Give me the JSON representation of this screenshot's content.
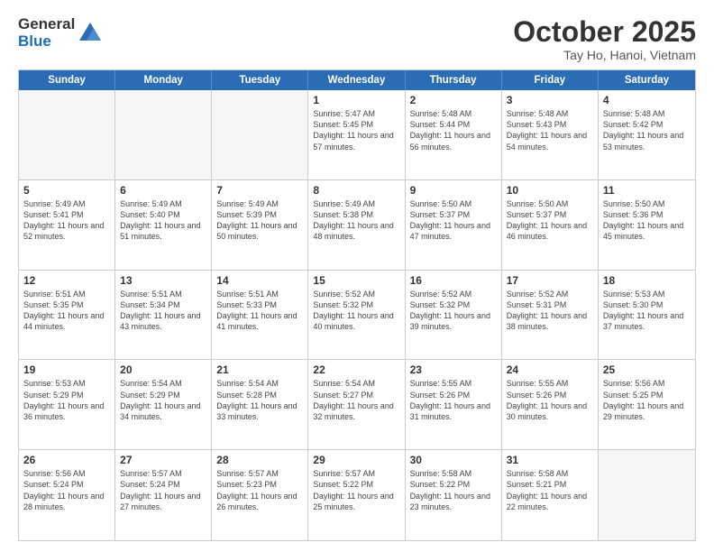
{
  "header": {
    "logo_general": "General",
    "logo_blue": "Blue",
    "month_title": "October 2025",
    "subtitle": "Tay Ho, Hanoi, Vietnam"
  },
  "days_of_week": [
    "Sunday",
    "Monday",
    "Tuesday",
    "Wednesday",
    "Thursday",
    "Friday",
    "Saturday"
  ],
  "weeks": [
    [
      {
        "day": "",
        "info": "",
        "empty": true
      },
      {
        "day": "",
        "info": "",
        "empty": true
      },
      {
        "day": "",
        "info": "",
        "empty": true
      },
      {
        "day": "1",
        "info": "Sunrise: 5:47 AM\nSunset: 5:45 PM\nDaylight: 11 hours\nand 57 minutes."
      },
      {
        "day": "2",
        "info": "Sunrise: 5:48 AM\nSunset: 5:44 PM\nDaylight: 11 hours\nand 56 minutes."
      },
      {
        "day": "3",
        "info": "Sunrise: 5:48 AM\nSunset: 5:43 PM\nDaylight: 11 hours\nand 54 minutes."
      },
      {
        "day": "4",
        "info": "Sunrise: 5:48 AM\nSunset: 5:42 PM\nDaylight: 11 hours\nand 53 minutes."
      }
    ],
    [
      {
        "day": "5",
        "info": "Sunrise: 5:49 AM\nSunset: 5:41 PM\nDaylight: 11 hours\nand 52 minutes."
      },
      {
        "day": "6",
        "info": "Sunrise: 5:49 AM\nSunset: 5:40 PM\nDaylight: 11 hours\nand 51 minutes."
      },
      {
        "day": "7",
        "info": "Sunrise: 5:49 AM\nSunset: 5:39 PM\nDaylight: 11 hours\nand 50 minutes."
      },
      {
        "day": "8",
        "info": "Sunrise: 5:49 AM\nSunset: 5:38 PM\nDaylight: 11 hours\nand 48 minutes."
      },
      {
        "day": "9",
        "info": "Sunrise: 5:50 AM\nSunset: 5:37 PM\nDaylight: 11 hours\nand 47 minutes."
      },
      {
        "day": "10",
        "info": "Sunrise: 5:50 AM\nSunset: 5:37 PM\nDaylight: 11 hours\nand 46 minutes."
      },
      {
        "day": "11",
        "info": "Sunrise: 5:50 AM\nSunset: 5:36 PM\nDaylight: 11 hours\nand 45 minutes."
      }
    ],
    [
      {
        "day": "12",
        "info": "Sunrise: 5:51 AM\nSunset: 5:35 PM\nDaylight: 11 hours\nand 44 minutes."
      },
      {
        "day": "13",
        "info": "Sunrise: 5:51 AM\nSunset: 5:34 PM\nDaylight: 11 hours\nand 43 minutes."
      },
      {
        "day": "14",
        "info": "Sunrise: 5:51 AM\nSunset: 5:33 PM\nDaylight: 11 hours\nand 41 minutes."
      },
      {
        "day": "15",
        "info": "Sunrise: 5:52 AM\nSunset: 5:32 PM\nDaylight: 11 hours\nand 40 minutes."
      },
      {
        "day": "16",
        "info": "Sunrise: 5:52 AM\nSunset: 5:32 PM\nDaylight: 11 hours\nand 39 minutes."
      },
      {
        "day": "17",
        "info": "Sunrise: 5:52 AM\nSunset: 5:31 PM\nDaylight: 11 hours\nand 38 minutes."
      },
      {
        "day": "18",
        "info": "Sunrise: 5:53 AM\nSunset: 5:30 PM\nDaylight: 11 hours\nand 37 minutes."
      }
    ],
    [
      {
        "day": "19",
        "info": "Sunrise: 5:53 AM\nSunset: 5:29 PM\nDaylight: 11 hours\nand 36 minutes."
      },
      {
        "day": "20",
        "info": "Sunrise: 5:54 AM\nSunset: 5:29 PM\nDaylight: 11 hours\nand 34 minutes."
      },
      {
        "day": "21",
        "info": "Sunrise: 5:54 AM\nSunset: 5:28 PM\nDaylight: 11 hours\nand 33 minutes."
      },
      {
        "day": "22",
        "info": "Sunrise: 5:54 AM\nSunset: 5:27 PM\nDaylight: 11 hours\nand 32 minutes."
      },
      {
        "day": "23",
        "info": "Sunrise: 5:55 AM\nSunset: 5:26 PM\nDaylight: 11 hours\nand 31 minutes."
      },
      {
        "day": "24",
        "info": "Sunrise: 5:55 AM\nSunset: 5:26 PM\nDaylight: 11 hours\nand 30 minutes."
      },
      {
        "day": "25",
        "info": "Sunrise: 5:56 AM\nSunset: 5:25 PM\nDaylight: 11 hours\nand 29 minutes."
      }
    ],
    [
      {
        "day": "26",
        "info": "Sunrise: 5:56 AM\nSunset: 5:24 PM\nDaylight: 11 hours\nand 28 minutes."
      },
      {
        "day": "27",
        "info": "Sunrise: 5:57 AM\nSunset: 5:24 PM\nDaylight: 11 hours\nand 27 minutes."
      },
      {
        "day": "28",
        "info": "Sunrise: 5:57 AM\nSunset: 5:23 PM\nDaylight: 11 hours\nand 26 minutes."
      },
      {
        "day": "29",
        "info": "Sunrise: 5:57 AM\nSunset: 5:22 PM\nDaylight: 11 hours\nand 25 minutes."
      },
      {
        "day": "30",
        "info": "Sunrise: 5:58 AM\nSunset: 5:22 PM\nDaylight: 11 hours\nand 23 minutes."
      },
      {
        "day": "31",
        "info": "Sunrise: 5:58 AM\nSunset: 5:21 PM\nDaylight: 11 hours\nand 22 minutes."
      },
      {
        "day": "",
        "info": "",
        "empty": true
      }
    ]
  ]
}
